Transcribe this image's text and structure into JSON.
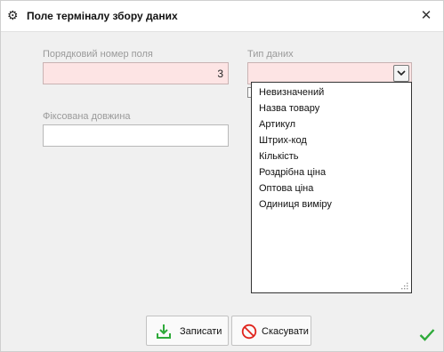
{
  "window": {
    "title": "Поле терміналу збору даних",
    "title_icon": "gear-icon",
    "close_icon": "close-icon"
  },
  "form": {
    "field_number": {
      "label": "Порядковий номер поля",
      "value": "3"
    },
    "data_type": {
      "label": "Тип даних",
      "value": ""
    },
    "fixed_length": {
      "label": "Фіксована довжина",
      "value": ""
    }
  },
  "dropdown": {
    "options": [
      "Невизначений",
      "Назва товару",
      "Артикул",
      "Штрих-код",
      "Кількість",
      "Роздрібна ціна",
      "Оптова ціна",
      "Одиниця виміру"
    ]
  },
  "buttons": {
    "save_label": "Записати",
    "cancel_label": "Скасувати"
  },
  "colors": {
    "required_bg": "#fde4e4",
    "save_icon": "#2eaa3a",
    "cancel_icon": "#e0231b"
  }
}
